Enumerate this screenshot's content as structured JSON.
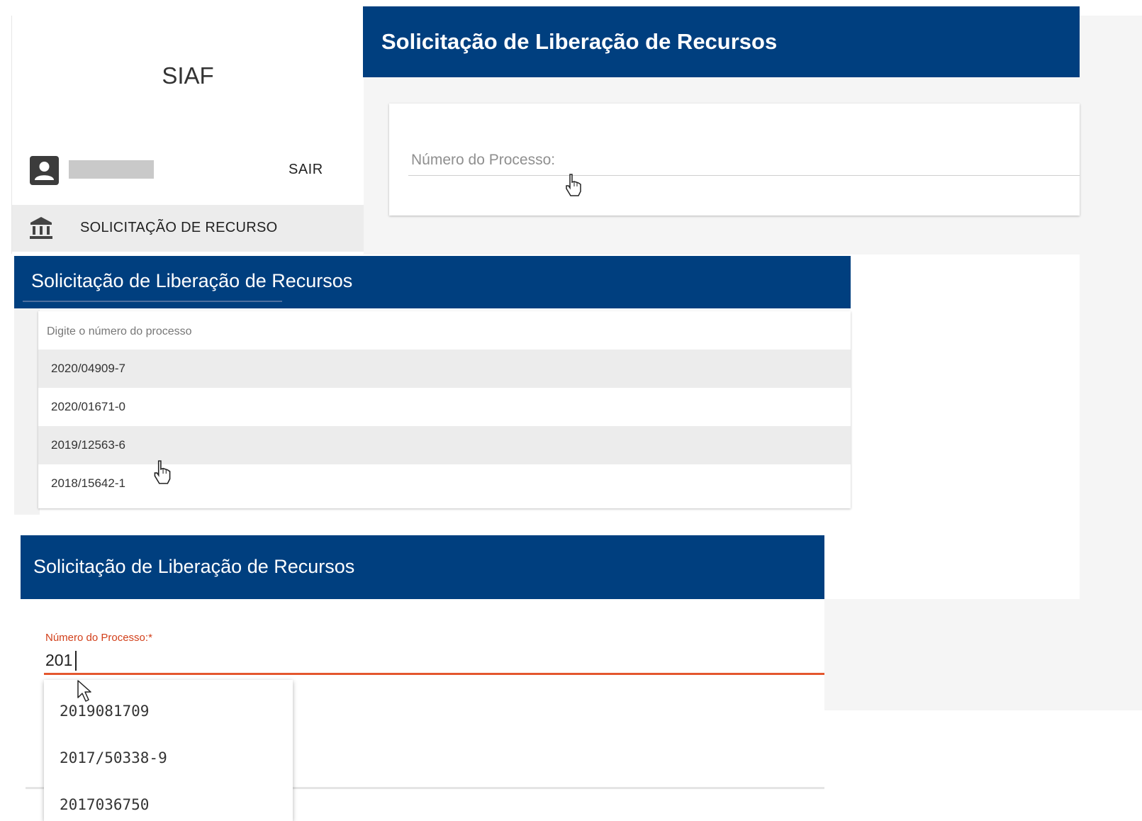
{
  "app": {
    "name": "SIAF"
  },
  "sidebar": {
    "logout_label": "SAIR",
    "nav_items": [
      {
        "label": "SOLICITAÇÃO DE RECURSO",
        "icon": "bank-icon"
      }
    ]
  },
  "page": {
    "title": "Solicitação de Liberação de Recursos"
  },
  "step1": {
    "field_label": "Número do Processo:"
  },
  "step2": {
    "placeholder": "Digite o número do processo",
    "options": [
      "2020/04909-7",
      "2020/01671-0",
      "2019/12563-6",
      "2018/15642-1"
    ]
  },
  "step3": {
    "field_label": "Número do Processo:*",
    "input_value": "201",
    "suggestions": [
      "2019081709",
      "2017/50338-9",
      "2017036750"
    ]
  },
  "colors": {
    "header_blue": "#003f7f",
    "error_red": "#e4572e",
    "highlight_gray": "#ececec"
  }
}
